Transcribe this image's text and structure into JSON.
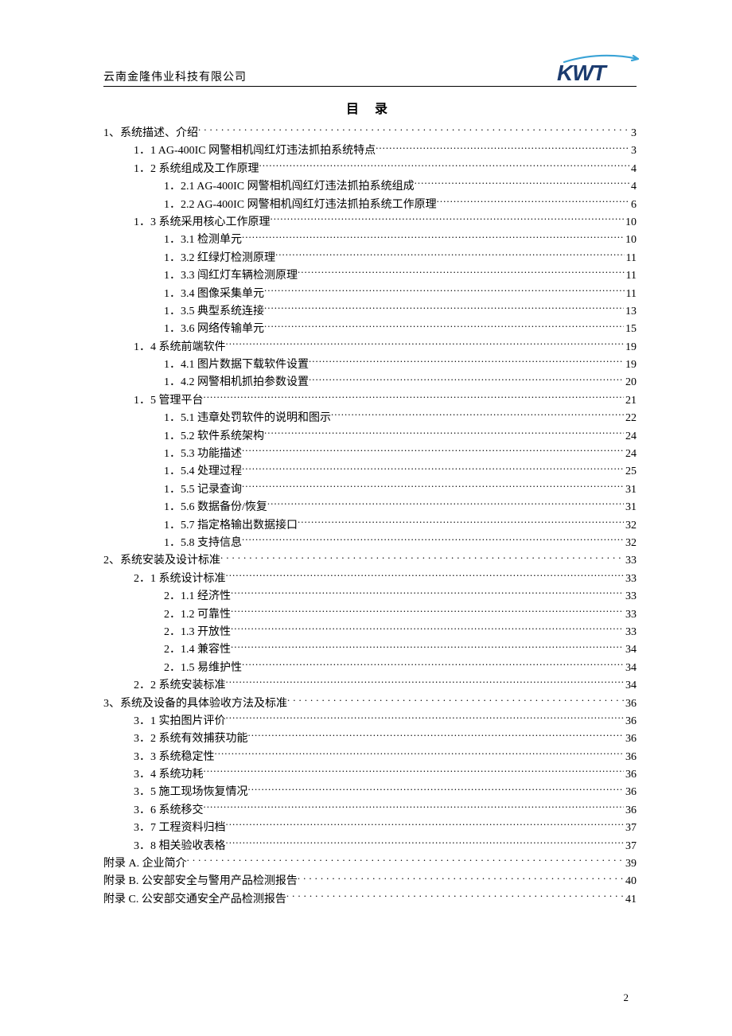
{
  "header": {
    "company": "云南金隆伟业科技有限公司",
    "logo_text": "KWT"
  },
  "toc_title": "目  录",
  "page_number": "2",
  "toc": [
    {
      "level": 1,
      "label": "1、系统描述、介绍",
      "page": "3"
    },
    {
      "level": 2,
      "label": "1．1 AG-400IC 网警相机闯红灯违法抓拍系统特点",
      "page": "3"
    },
    {
      "level": 2,
      "label": "1．2 系统组成及工作原理",
      "page": "4"
    },
    {
      "level": 3,
      "label": "1．2.1 AG-400IC 网警相机闯红灯违法抓拍系统组成",
      "page": "4"
    },
    {
      "level": 3,
      "label": "1．2.2 AG-400IC 网警相机闯红灯违法抓拍系统工作原理",
      "page": "6"
    },
    {
      "level": 2,
      "label": "1．3 系统采用核心工作原理",
      "page": "10"
    },
    {
      "level": 3,
      "label": "1．3.1 检测单元",
      "page": "10"
    },
    {
      "level": 3,
      "label": "1．3.2 红绿灯检测原理",
      "page": "11"
    },
    {
      "level": 3,
      "label": "1．3.3 闯红灯车辆检测原理",
      "page": "11"
    },
    {
      "level": 3,
      "label": "1．3.4 图像采集单元",
      "page": "11"
    },
    {
      "level": 3,
      "label": "1．3.5 典型系统连接",
      "page": "13"
    },
    {
      "level": 3,
      "label": "1．3.6 网络传输单元",
      "page": "15"
    },
    {
      "level": 2,
      "label": "1．4 系统前端软件",
      "page": "19"
    },
    {
      "level": 3,
      "label": "1．4.1 图片数据下载软件设置",
      "page": "19"
    },
    {
      "level": 3,
      "label": "1．4.2 网警相机抓拍参数设置",
      "page": "20"
    },
    {
      "level": 2,
      "label": "1．5 管理平台",
      "page": "21"
    },
    {
      "level": 3,
      "label": "1．5.1 违章处罚软件的说明和图示",
      "page": "22"
    },
    {
      "level": 3,
      "label": "1．5.2 软件系统架构",
      "page": "24"
    },
    {
      "level": 3,
      "label": "1．5.3 功能描述",
      "page": "24"
    },
    {
      "level": 3,
      "label": "1．5.4 处理过程",
      "page": "25"
    },
    {
      "level": 3,
      "label": "1．5.5 记录查询",
      "page": "31"
    },
    {
      "level": 3,
      "label": "1．5.6 数据备份/恢复",
      "page": "31"
    },
    {
      "level": 3,
      "label": "1．5.7 指定格输出数据接口",
      "page": "32"
    },
    {
      "level": 3,
      "label": "1．5.8 支持信息",
      "page": "32"
    },
    {
      "level": 1,
      "label": "2、系统安装及设计标准",
      "page": "33"
    },
    {
      "level": 2,
      "label": "2．1 系统设计标准",
      "page": "33"
    },
    {
      "level": 3,
      "label": "2．1.1 经济性",
      "page": "33"
    },
    {
      "level": 3,
      "label": "2．1.2 可靠性",
      "page": "33"
    },
    {
      "level": 3,
      "label": "2．1.3 开放性",
      "page": "33"
    },
    {
      "level": 3,
      "label": "2．1.4 兼容性",
      "page": "34"
    },
    {
      "level": 3,
      "label": "2．1.5 易维护性",
      "page": "34"
    },
    {
      "level": 2,
      "label": "2．2 系统安装标准",
      "page": "34"
    },
    {
      "level": 1,
      "label": "3、系统及设备的具体验收方法及标准",
      "page": "36"
    },
    {
      "level": 2,
      "label": "3．1 实拍图片评价",
      "page": "36"
    },
    {
      "level": 2,
      "label": "3．2 系统有效捕获功能",
      "page": "36"
    },
    {
      "level": 2,
      "label": "3．3 系统稳定性",
      "page": "36"
    },
    {
      "level": 2,
      "label": "3．4 系统功耗",
      "page": "36"
    },
    {
      "level": 2,
      "label": "3．5 施工现场恢复情况",
      "page": "36"
    },
    {
      "level": 2,
      "label": "3．6 系统移交",
      "page": "36"
    },
    {
      "level": 2,
      "label": "3．7 工程资料归档",
      "page": "37"
    },
    {
      "level": 2,
      "label": "3．8 相关验收表格",
      "page": "37"
    },
    {
      "level": 1,
      "label": "附录 A. 企业简介",
      "page": "39"
    },
    {
      "level": 1,
      "label": "附录 B. 公安部安全与警用产品检测报告",
      "page": "40"
    },
    {
      "level": 1,
      "label": "附录 C. 公安部交通安全产品检测报告",
      "page": "41"
    }
  ]
}
